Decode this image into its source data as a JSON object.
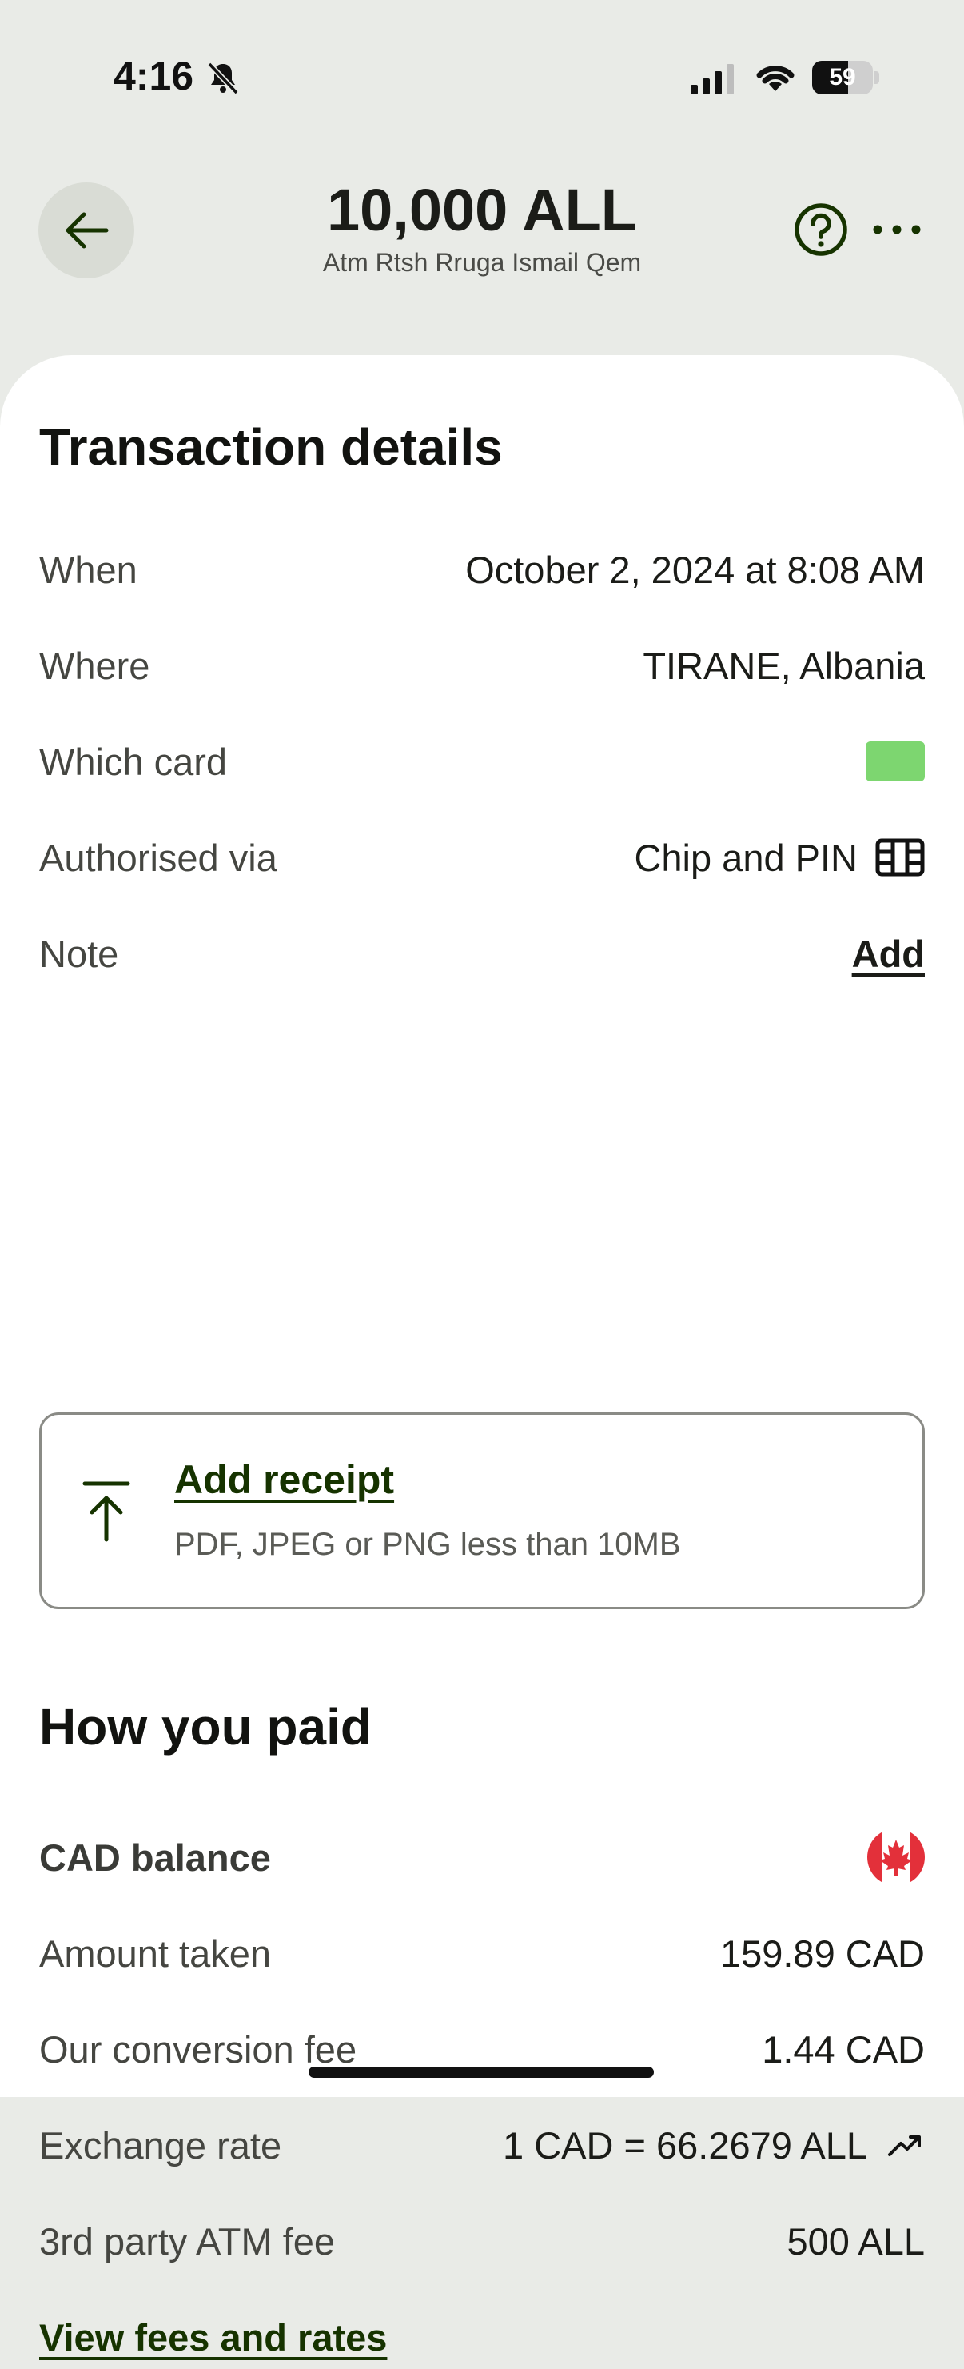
{
  "status_bar": {
    "time": "4:16",
    "battery_level": "59",
    "battery_fraction": 0.59
  },
  "header": {
    "amount": "10,000 ALL",
    "merchant": "Atm Rtsh Rruga Ismail Qem"
  },
  "transaction_details": {
    "title": "Transaction details",
    "rows": [
      {
        "label": "When",
        "value": "October 2, 2024 at 8:08 AM"
      },
      {
        "label": "Where",
        "value": "TIRANE, Albania"
      },
      {
        "label": "Which card",
        "value": ""
      },
      {
        "label": "Authorised via",
        "value": "Chip and PIN"
      },
      {
        "label": "Note",
        "value": "Add"
      }
    ],
    "card_color": "#7DD670"
  },
  "receipt": {
    "title": "Add receipt",
    "subtitle": "PDF, JPEG or PNG less than 10MB"
  },
  "how_you_paid": {
    "title": "How you paid",
    "balance_label": "CAD balance",
    "rows": [
      {
        "label": "Amount taken",
        "value": "159.89 CAD"
      },
      {
        "label": "Our conversion fee",
        "value": "1.44 CAD"
      },
      {
        "label": "Exchange rate",
        "value": "1 CAD = 66.2679 ALL"
      },
      {
        "label": "3rd party ATM fee",
        "value": "500 ALL"
      }
    ],
    "view_fees_link": "View fees and rates"
  },
  "colors": {
    "accent": "#163300",
    "header_bg": "#E9EBE7",
    "card": "#7DD670",
    "flag_red": "#E3303A"
  }
}
